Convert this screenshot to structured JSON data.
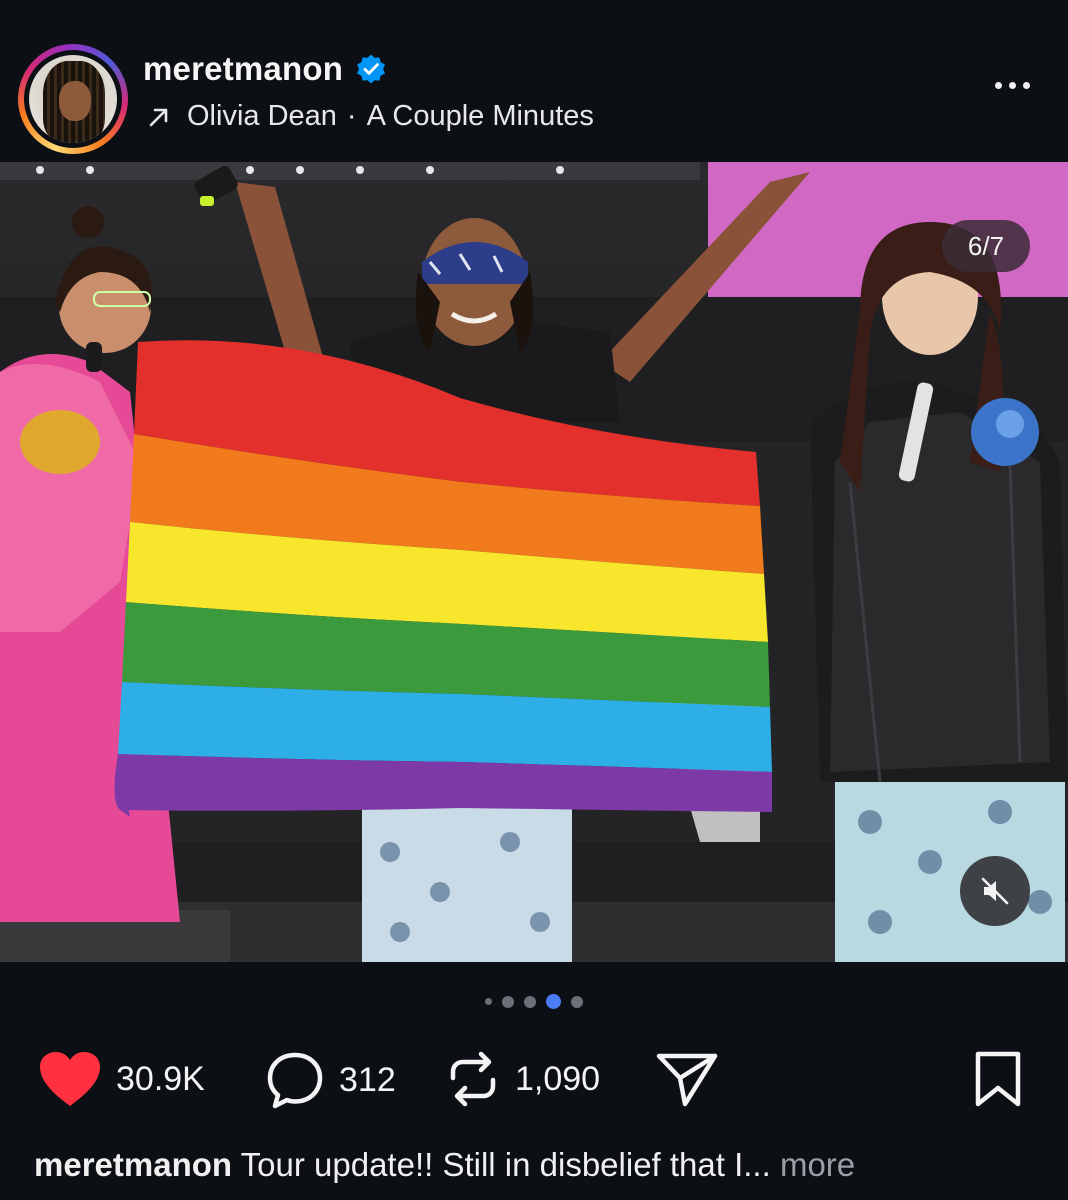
{
  "header": {
    "username": "meretmanon",
    "verified": true,
    "song": {
      "artist": "Olivia Dean",
      "separator": "·",
      "title": "A Couple Minutes"
    }
  },
  "media": {
    "counter": "6/7",
    "muted": true,
    "carousel_total": 7,
    "carousel_current": 6
  },
  "actions": {
    "likes": "30.9K",
    "comments": "312",
    "reposts": "1,090",
    "liked": true
  },
  "caption": {
    "username": "meretmanon",
    "text": "Tour update!! Still in disbelief that I...",
    "more_label": "more"
  },
  "colors": {
    "background": "#0c0f14",
    "like_red": "#ff3040",
    "verified_blue": "#0095f6",
    "active_dot": "#4a7cf5"
  }
}
